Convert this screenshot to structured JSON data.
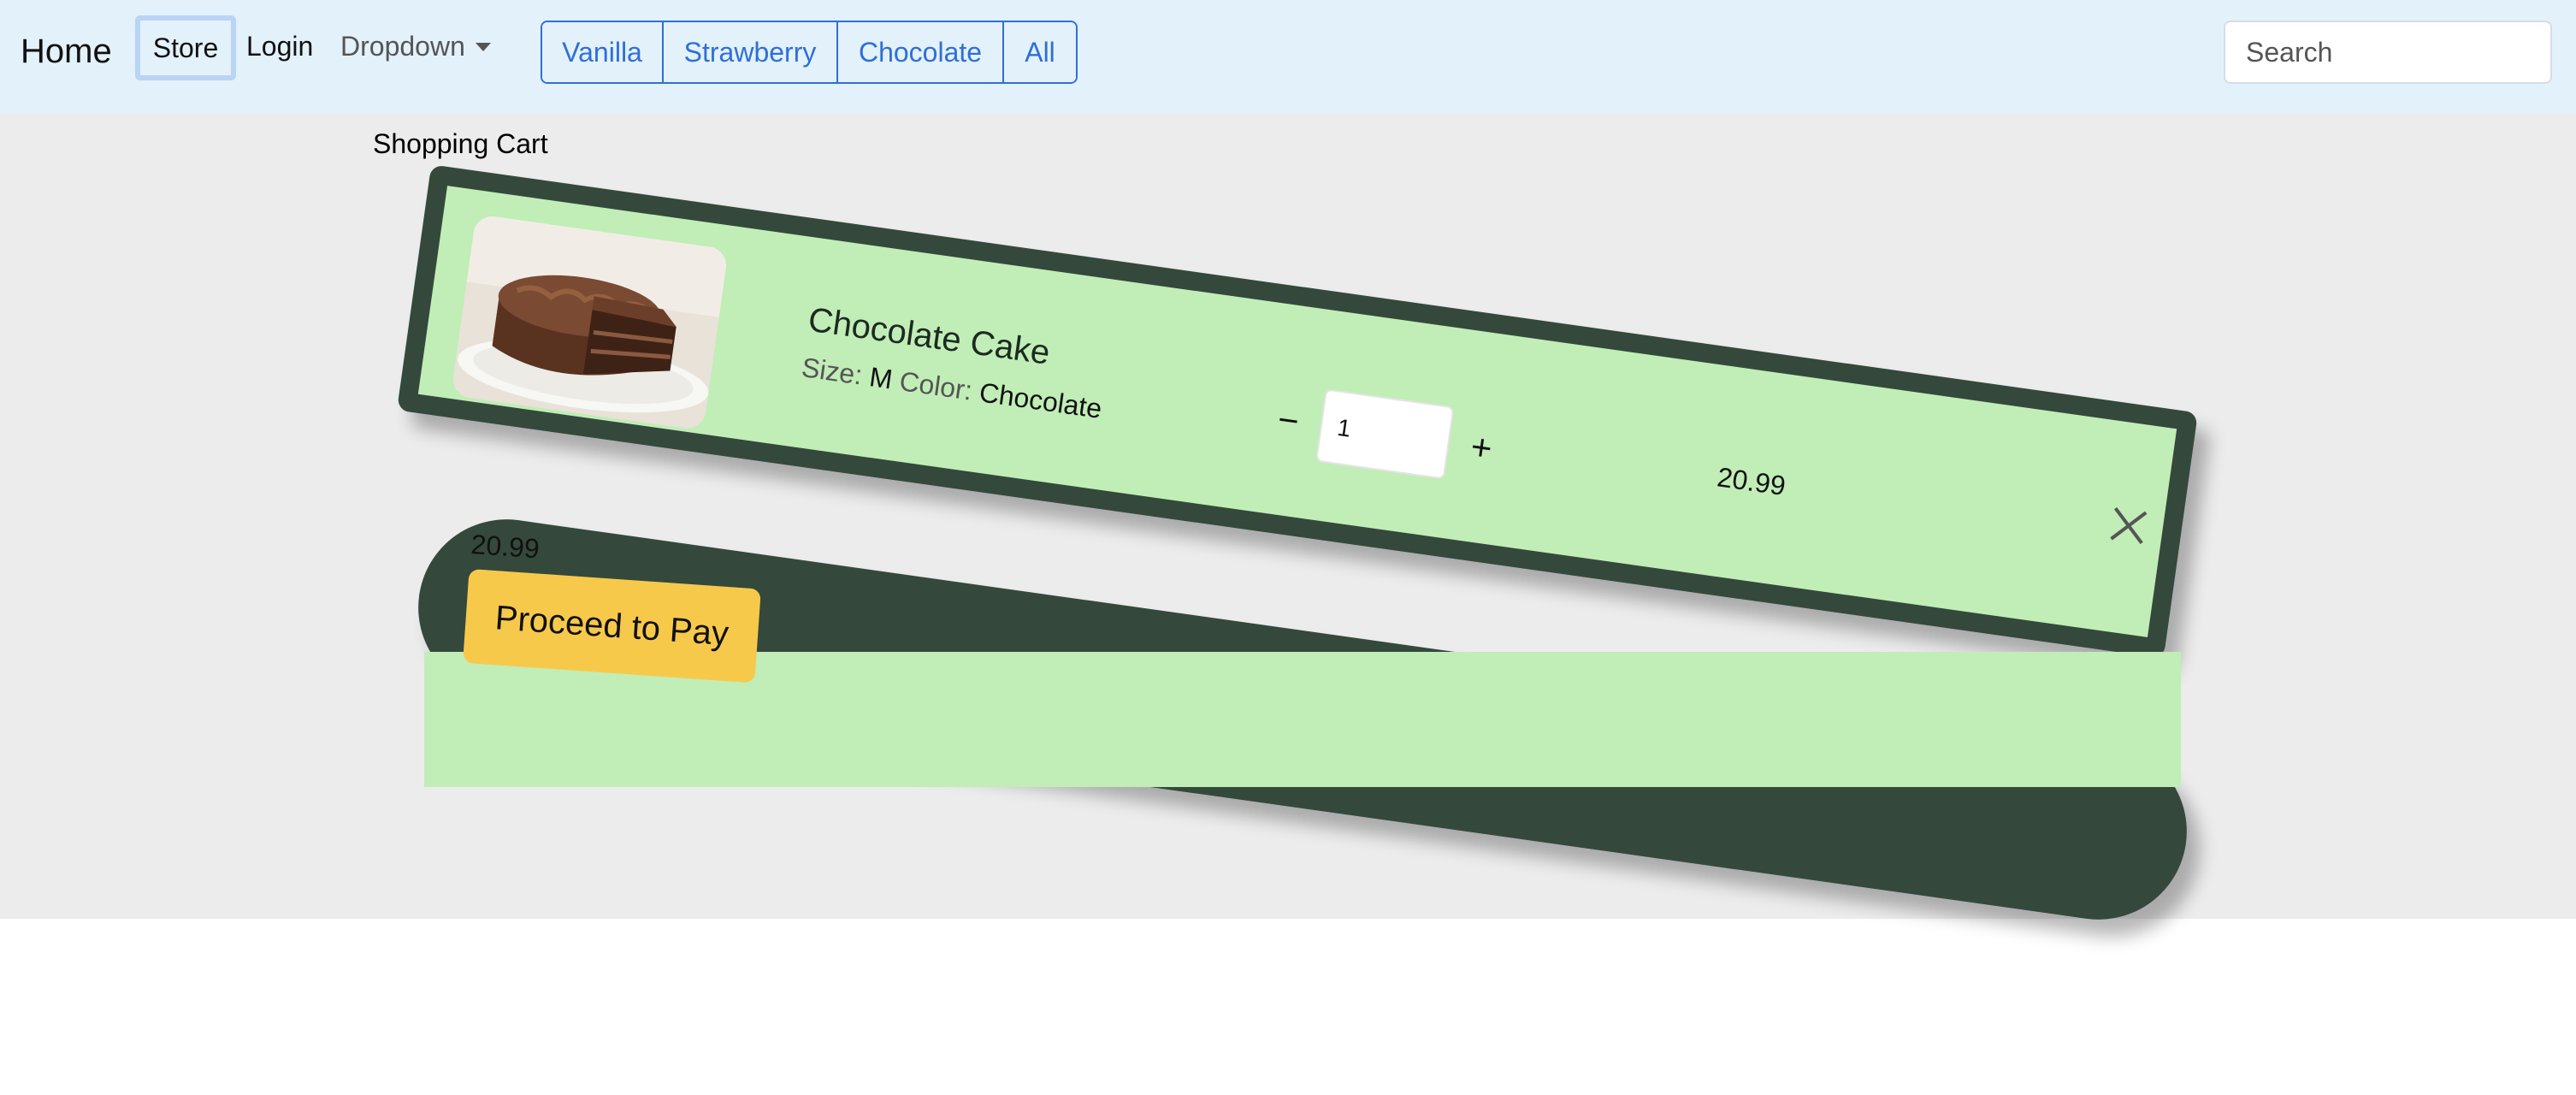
{
  "nav": {
    "brand": "Home",
    "store": "Store",
    "login": "Login",
    "dropdown": "Dropdown",
    "flavors": [
      "Vanilla",
      "Strawberry",
      "Chocolate",
      "All"
    ],
    "search_placeholder": "Search"
  },
  "cart": {
    "title": "Shopping Cart",
    "item": {
      "name": "Chocolate Cake",
      "size_label": "Size:",
      "size": "M",
      "color_label": "Color:",
      "color": "Chocolate",
      "quantity": "1",
      "minus": "−",
      "plus": "+",
      "price": "20.99"
    },
    "total": "20.99",
    "pay_label": "Proceed to Pay"
  },
  "colors": {
    "nav_bg": "#e3f1fb",
    "accent": "#2f6fd6",
    "card_bg": "#c1edb7",
    "card_border": "#34493c",
    "pay_button": "#f7c94b",
    "page_bg": "#ececec"
  }
}
